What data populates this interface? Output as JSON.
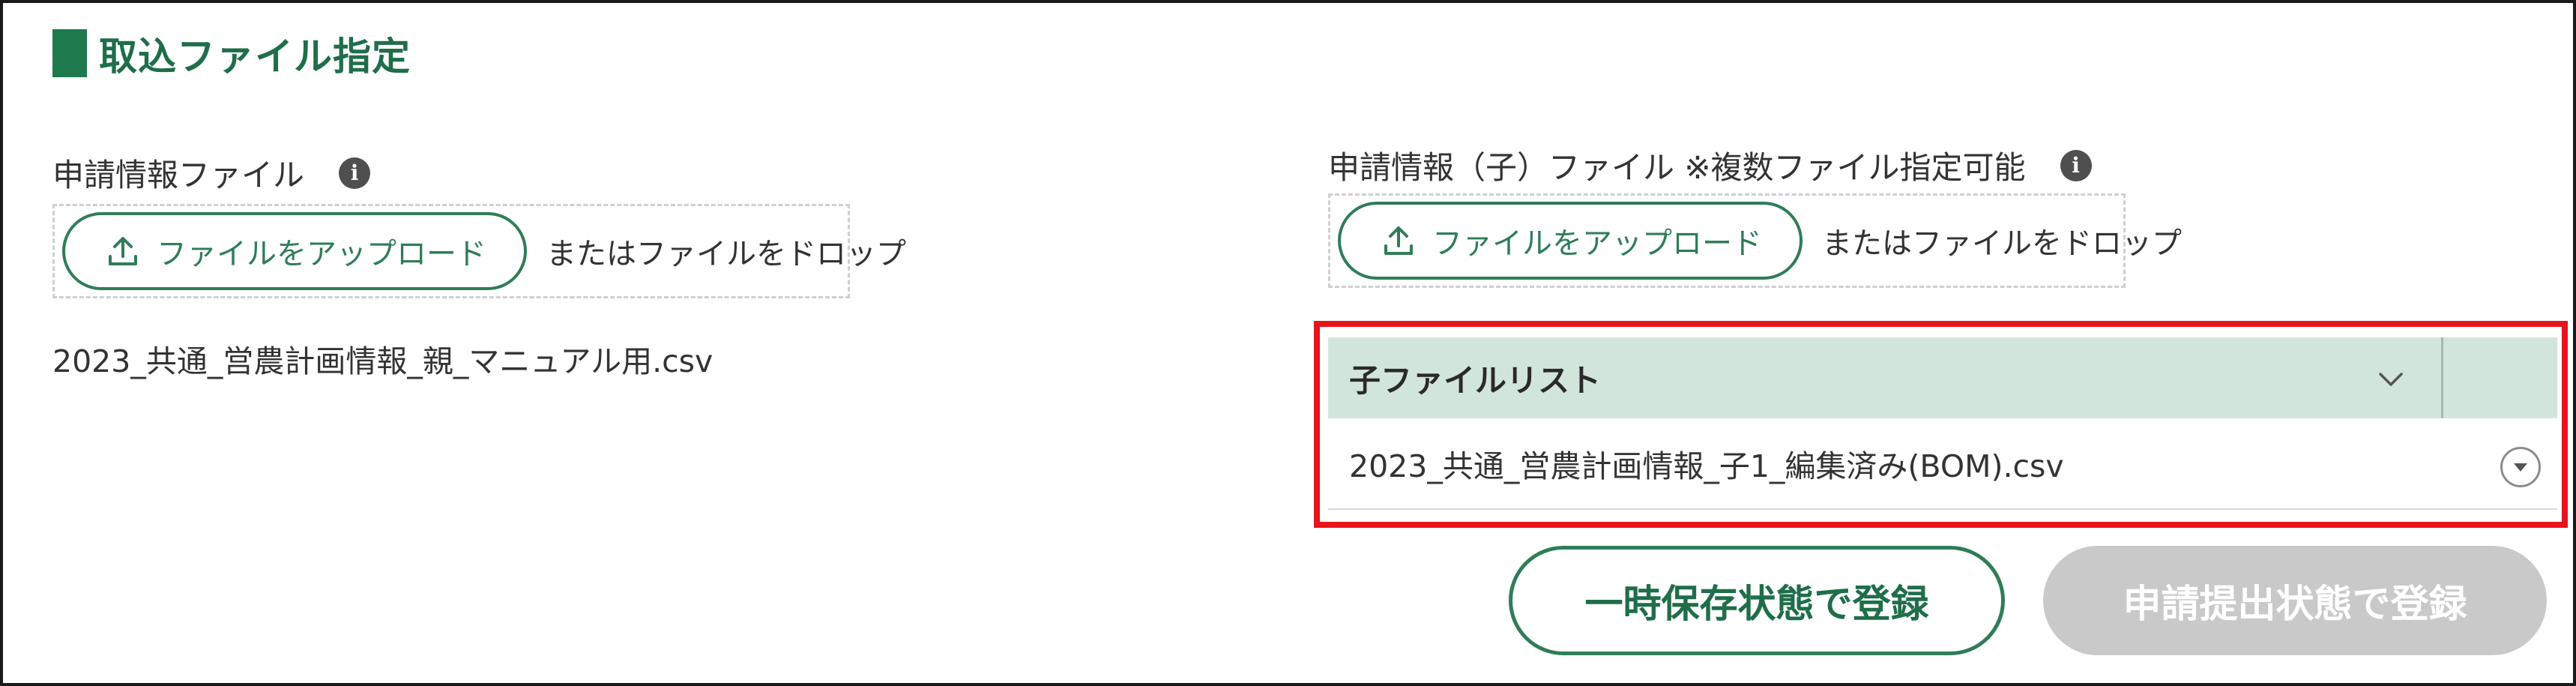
{
  "section": {
    "title": "取込ファイル指定"
  },
  "parent_file": {
    "label": "申請情報ファイル",
    "info_icon": "info-icon",
    "upload_label": "ファイルをアップロード",
    "drop_text": "またはファイルをドロップ",
    "selected_file": "2023_共通_営農計画情報_親_マニュアル用.csv"
  },
  "child_file": {
    "label": "申請情報（子）ファイル ※複数ファイル指定可能",
    "info_icon": "info-icon",
    "upload_label": "ファイルをアップロード",
    "drop_text": "またはファイルをドロップ"
  },
  "child_list": {
    "header": "子ファイルリスト",
    "rows": [
      {
        "name": "2023_共通_営農計画情報_子1_編集済み(BOM).csv"
      }
    ]
  },
  "actions": {
    "save_label": "一時保存状態で登録",
    "submit_label": "申請提出状態で登録"
  },
  "colors": {
    "brand_green": "#2f7d57",
    "header_bg": "#d2e5db",
    "highlight_red": "#e8141c",
    "disabled_gray": "#c9c9c9"
  }
}
